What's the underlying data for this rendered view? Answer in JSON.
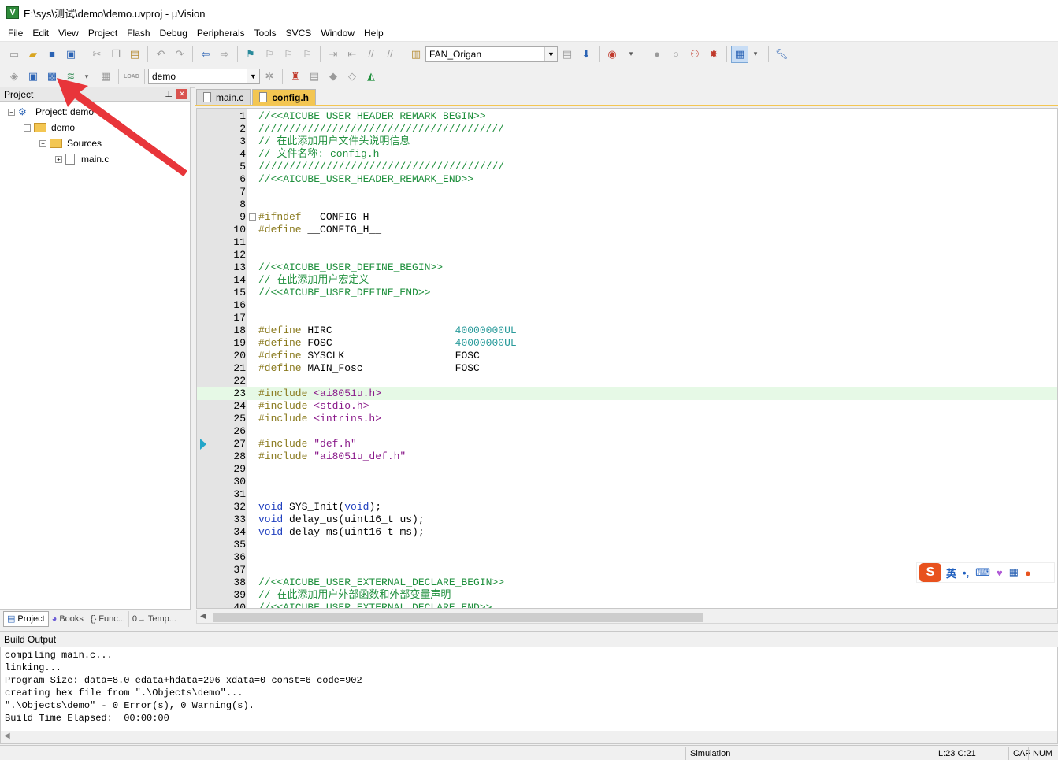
{
  "window": {
    "title": "E:\\sys\\测试\\demo\\demo.uvproj - µVision",
    "app_icon": "V"
  },
  "menu": [
    "File",
    "Edit",
    "View",
    "Project",
    "Flash",
    "Debug",
    "Peripherals",
    "Tools",
    "SVCS",
    "Window",
    "Help"
  ],
  "toolbar1": {
    "target_combo": "FAN_Origan"
  },
  "toolbar2": {
    "load_label": "LOAD",
    "target_select": "demo"
  },
  "project_panel": {
    "title": "Project",
    "tree": {
      "root": "Project: demo",
      "target": "demo",
      "group": "Sources",
      "file": "main.c"
    },
    "tabs": [
      "Project",
      "Books",
      "{} Func...",
      "0→ Temp..."
    ]
  },
  "editor": {
    "tabs": [
      "main.c",
      "config.h"
    ],
    "active_tab": "config.h",
    "current_line": 23,
    "lines": [
      {
        "n": "1",
        "t": "//<<AICUBE_USER_HEADER_REMARK_BEGIN>>"
      },
      {
        "n": "2",
        "t": "////////////////////////////////////////"
      },
      {
        "n": "3",
        "t": "// 在此添加用户文件头说明信息"
      },
      {
        "n": "4",
        "t": "// 文件名称: config.h"
      },
      {
        "n": "5",
        "t": "////////////////////////////////////////"
      },
      {
        "n": "6",
        "t": "//<<AICUBE_USER_HEADER_REMARK_END>>"
      },
      {
        "n": "7",
        "t": ""
      },
      {
        "n": "8",
        "t": ""
      },
      {
        "n": "9",
        "t": "#ifndef __CONFIG_H__"
      },
      {
        "n": "10",
        "t": "#define __CONFIG_H__"
      },
      {
        "n": "11",
        "t": ""
      },
      {
        "n": "12",
        "t": ""
      },
      {
        "n": "13",
        "t": "//<<AICUBE_USER_DEFINE_BEGIN>>"
      },
      {
        "n": "14",
        "t": "// 在此添加用户宏定义"
      },
      {
        "n": "15",
        "t": "//<<AICUBE_USER_DEFINE_END>>"
      },
      {
        "n": "16",
        "t": ""
      },
      {
        "n": "17",
        "t": ""
      },
      {
        "n": "18",
        "t": "#define HIRC                    40000000UL"
      },
      {
        "n": "19",
        "t": "#define FOSC                    40000000UL"
      },
      {
        "n": "20",
        "t": "#define SYSCLK                  FOSC"
      },
      {
        "n": "21",
        "t": "#define MAIN_Fosc               FOSC"
      },
      {
        "n": "22",
        "t": ""
      },
      {
        "n": "23",
        "t": "#include <ai8051u.h>"
      },
      {
        "n": "24",
        "t": "#include <stdio.h>"
      },
      {
        "n": "25",
        "t": "#include <intrins.h>"
      },
      {
        "n": "26",
        "t": ""
      },
      {
        "n": "27",
        "t": "#include \"def.h\""
      },
      {
        "n": "28",
        "t": "#include \"ai8051u_def.h\""
      },
      {
        "n": "29",
        "t": ""
      },
      {
        "n": "30",
        "t": ""
      },
      {
        "n": "31",
        "t": ""
      },
      {
        "n": "32",
        "t": "void SYS_Init(void);"
      },
      {
        "n": "33",
        "t": "void delay_us(uint16_t us);"
      },
      {
        "n": "34",
        "t": "void delay_ms(uint16_t ms);"
      },
      {
        "n": "35",
        "t": ""
      },
      {
        "n": "36",
        "t": ""
      },
      {
        "n": "37",
        "t": ""
      },
      {
        "n": "38",
        "t": "//<<AICUBE_USER_EXTERNAL_DECLARE_BEGIN>>"
      },
      {
        "n": "39",
        "t": "// 在此添加用户外部函数和外部变量声明"
      },
      {
        "n": "40",
        "t": "//<<AICUBE_USER_EXTERNAL_DECLARE_END>>"
      }
    ]
  },
  "ime": {
    "logo": "S",
    "mode": "英",
    "punct": "•,",
    "keyboard": "⌨"
  },
  "build_output": {
    "title": "Build Output",
    "lines": [
      "compiling main.c...",
      "linking...",
      "Program Size: data=8.0 edata+hdata=296 xdata=0 const=6 code=902",
      "creating hex file from \".\\Objects\\demo\"...",
      "\".\\Objects\\demo\" - 0 Error(s), 0 Warning(s).",
      "Build Time Elapsed:  00:00:00"
    ]
  },
  "status": {
    "mode": "Simulation",
    "position": "L:23 C:21",
    "cap": "CAP",
    "num": "NUM"
  },
  "colors": {
    "comment": "#1e8f3c",
    "preprocessor": "#8a7a1e",
    "keyword": "#1f3fbf",
    "string": "#8a1a8a",
    "number": "#2a9b9b",
    "active_tab": "#f3c652",
    "annotation_arrow": "#e8353a"
  }
}
